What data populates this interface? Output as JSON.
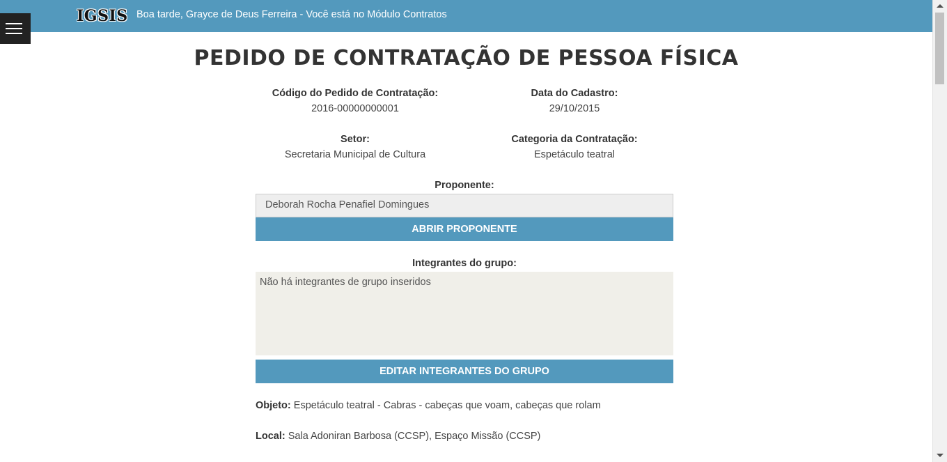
{
  "header": {
    "logo": "IGSIS",
    "greeting": "Boa tarde, Grayce de Deus Ferreira - Você está no Módulo Contratos",
    "menu_icon": "hamburger-icon"
  },
  "page": {
    "title": "PEDIDO DE CONTRATAÇÃO DE PESSOA FÍSICA"
  },
  "details": {
    "codigo_label": "Código do Pedido de Contratação:",
    "codigo_value": "2016-00000000001",
    "data_label": "Data do Cadastro:",
    "data_value": "29/10/2015",
    "setor_label": "Setor:",
    "setor_value": "Secretaria Municipal de Cultura",
    "categoria_label": "Categoria da Contratação:",
    "categoria_value": "Espetáculo teatral"
  },
  "proponente": {
    "label": "Proponente:",
    "value": "Deborah Rocha Penafiel Domingues",
    "button": "ABRIR PROPONENTE"
  },
  "integrantes": {
    "label": "Integrantes do grupo:",
    "value": "Não há integrantes de grupo inseridos",
    "button": "EDITAR INTEGRANTES DO GRUPO"
  },
  "objeto": {
    "label": "Objeto:",
    "value": "Espetáculo teatral - Cabras - cabeças que voam, cabeças que rolam"
  },
  "local": {
    "label": "Local:",
    "value": "Sala Adoniran Barbosa (CCSP), Espaço Missão (CCSP)"
  },
  "colors": {
    "accent": "#5399bd",
    "menu_bg": "#222222",
    "textarea_bg": "#f0efe9"
  }
}
